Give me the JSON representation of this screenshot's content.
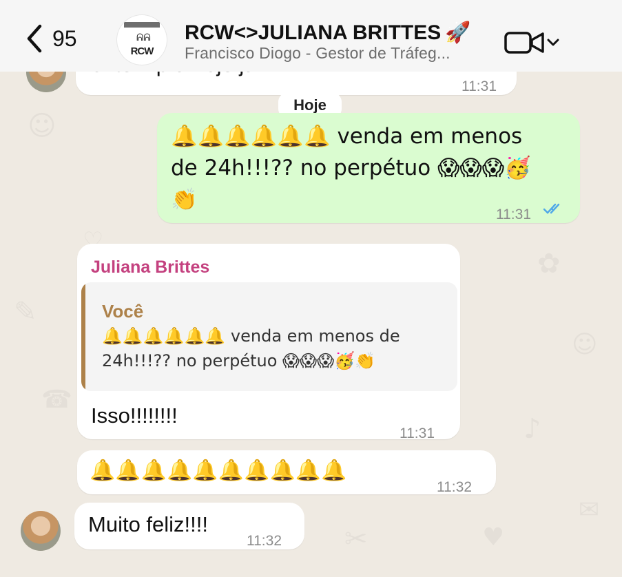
{
  "header": {
    "back_count": "95",
    "group_avatar_text": "RCW",
    "title": "RCW<>JULIANA BRITTES",
    "title_emoji": "🚀",
    "subtitle": "Francisco Diogo - Gestor de Tráfeg..."
  },
  "chat": {
    "date_divider": "Hoje",
    "messages": [
      {
        "text": "ontem pra hoje já?",
        "time": "11:31"
      },
      {
        "text_line1": "🔔🔔🔔🔔🔔🔔 venda em menos",
        "text_line2": "de 24h!!!?? no perpétuo 😱😱😱🥳",
        "text_line3": "👏",
        "time": "11:31"
      },
      {
        "sender": "Juliana Brittes",
        "quote_author": "Você",
        "quote_text": "🔔🔔🔔🔔🔔🔔 venda em menos de 24h!!!?? no perpétuo 😱😱😱🥳👏",
        "text": "Isso!!!!!!!!",
        "time": "11:31"
      },
      {
        "text": "🔔🔔🔔🔔🔔🔔🔔🔔🔔🔔",
        "time": "11:32"
      },
      {
        "text": "Muito feliz!!!!",
        "time": "11:32"
      }
    ]
  },
  "colors": {
    "outgoing_bubble": "#dafcd0",
    "incoming_bubble": "#ffffff",
    "sender_name": "#c4417f",
    "quote_accent": "#ad8149",
    "read_ticks": "#4fa8e8",
    "background": "#efeae2"
  },
  "icons": {
    "back": "chevron-left-icon",
    "video_call": "video-camera-icon",
    "dropdown": "chevron-down-icon",
    "read_receipt": "double-check-icon"
  }
}
